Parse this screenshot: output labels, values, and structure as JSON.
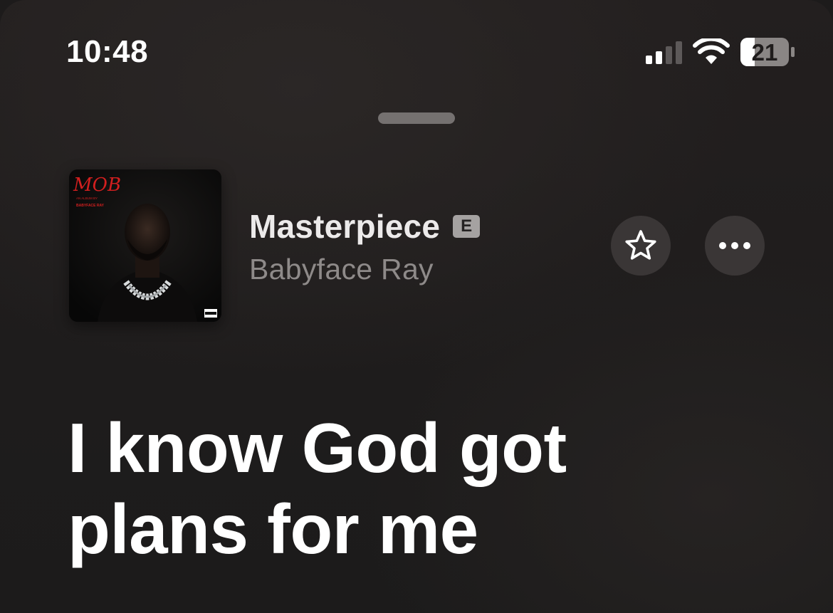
{
  "status_bar": {
    "time": "10:48",
    "battery_level": "21",
    "signal_bars_active": 2,
    "signal_bars_total": 4
  },
  "now_playing": {
    "title": "Masterpiece",
    "explicit_label": "E",
    "artist": "Babyface Ray",
    "artwork": {
      "album_text": "MOB",
      "album_subtitle": "AN ALBUM BY",
      "artist_text": "BABYFACE RAY"
    }
  },
  "actions": {
    "favorite_icon": "star-outline-icon",
    "more_icon": "ellipsis-icon"
  },
  "lyrics": {
    "lines": [
      "I know God got",
      "plans for me"
    ]
  },
  "colors": {
    "background": "#1e1c1c",
    "title": "#eceaea",
    "artist": "#8e8a89",
    "button_bg": "#3a3636",
    "album_accent": "#d21f1f"
  }
}
